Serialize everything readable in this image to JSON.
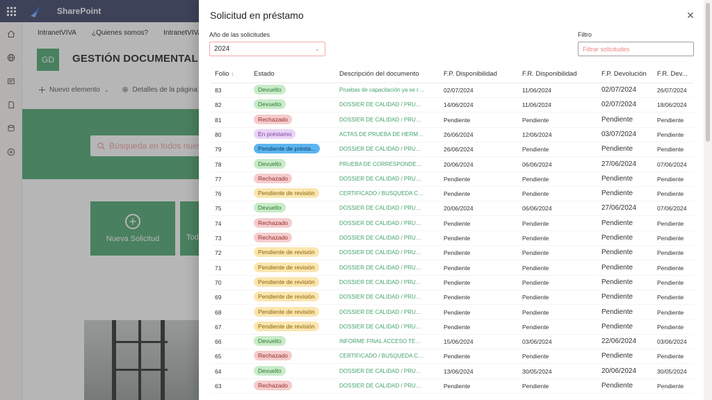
{
  "suite": {
    "app_name": "SharePoint"
  },
  "hub_nav": [
    "IntranetVIVA",
    "¿Quienes somos?",
    "IntranetVIVA"
  ],
  "site": {
    "logo_text": "GD",
    "title": "GESTIÓN DOCUMENTAL VIVA"
  },
  "command_bar": {
    "new_item": "Nuevo elemento",
    "page_details": "Detalles de la página"
  },
  "hero": {
    "search_placeholder": "Búsqueda en todos nuestros documentos"
  },
  "tiles": [
    {
      "label": "Nueva Solicitud"
    },
    {
      "label": "Todas"
    }
  ],
  "panel": {
    "title": "Solicitud en préstamo",
    "year_label": "Año de las solicitudes",
    "year_value": "2024",
    "filter_label": "Filtro",
    "filter_placeholder": "Filtrar solicitudes",
    "columns": {
      "folio": "Folio",
      "estado": "Estado",
      "descripcion": "Descripción del documento",
      "fp_disp": "F.P. Disponibilidad",
      "fr_disp": "F.R. Disponibilidad",
      "fp_dev": "F.P. Devolución",
      "fr_dev": "F.R. Dev..."
    },
    "rows": [
      {
        "folio": "83",
        "estado": "Devuelto",
        "status": "devuelto",
        "descripcion": "Pruebas de capacitación ya se re...",
        "fp_disp": "02/07/2024",
        "fr_disp": "11/06/2024",
        "fp_dev": "02/07/2024",
        "fr_dev": "26/07/2024"
      },
      {
        "folio": "82",
        "estado": "Devuelto",
        "status": "devuelto",
        "descripcion": "DOSSIER DE CALIDAD / PRUEBA...",
        "fp_disp": "14/06/2024",
        "fr_disp": "11/06/2024",
        "fp_dev": "02/07/2024",
        "fr_dev": "18/06/2024"
      },
      {
        "folio": "81",
        "estado": "Rechazado",
        "status": "rechazado",
        "descripcion": "DOSSIER DE CALIDAD / PRUEBA...",
        "fp_disp": "Pendiente",
        "fr_disp": "Pendiente",
        "fp_dev": "Pendiente",
        "fr_dev": "Pendiente"
      },
      {
        "folio": "80",
        "estado": "En préstamo",
        "status": "prestamo",
        "descripcion": "ACTAS DE PRUEBA DE HERMETI...",
        "fp_disp": "26/06/2024",
        "fr_disp": "12/06/2024",
        "fp_dev": "03/07/2024",
        "fr_dev": "Pendiente"
      },
      {
        "folio": "79",
        "estado": "Pendiente de présta...",
        "status": "pendprest",
        "descripcion": "DOSSIER DE CALIDAD / PRUEBA...",
        "fp_disp": "26/06/2024",
        "fr_disp": "Pendiente",
        "fp_dev": "Pendiente",
        "fr_dev": "Pendiente"
      },
      {
        "folio": "78",
        "estado": "Devuelto",
        "status": "devuelto",
        "descripcion": "PRUEBA DE CORRESPONDENCIA",
        "fp_disp": "20/06/2024",
        "fr_disp": "06/06/2024",
        "fp_dev": "27/06/2024",
        "fr_dev": "07/06/2024"
      },
      {
        "folio": "77",
        "estado": "Rechazado",
        "status": "rechazado",
        "descripcion": "DOSSIER DE CALIDAD / PRUEBA...",
        "fp_disp": "Pendiente",
        "fr_disp": "Pendiente",
        "fp_dev": "Pendiente",
        "fr_dev": "Pendiente"
      },
      {
        "folio": "76",
        "estado": "Pendiente de revisión",
        "status": "revision",
        "descripcion": "CERTIFICADO / BUSQUEDA CAT...",
        "fp_disp": "Pendiente",
        "fr_disp": "Pendiente",
        "fp_dev": "Pendiente",
        "fr_dev": "Pendiente"
      },
      {
        "folio": "75",
        "estado": "Devuelto",
        "status": "devuelto",
        "descripcion": "DOSSIER DE CALIDAD / PRUEBA...",
        "fp_disp": "20/06/2024",
        "fr_disp": "06/06/2024",
        "fp_dev": "27/06/2024",
        "fr_dev": "07/06/2024"
      },
      {
        "folio": "74",
        "estado": "Rechazado",
        "status": "rechazado",
        "descripcion": "DOSSIER DE CALIDAD / PRUEBA...",
        "fp_disp": "Pendiente",
        "fr_disp": "Pendiente",
        "fp_dev": "Pendiente",
        "fr_dev": "Pendiente"
      },
      {
        "folio": "73",
        "estado": "Rechazado",
        "status": "rechazado",
        "descripcion": "DOSSIER DE CALIDAD / PRUEBA...",
        "fp_disp": "Pendiente",
        "fr_disp": "Pendiente",
        "fp_dev": "Pendiente",
        "fr_dev": "Pendiente"
      },
      {
        "folio": "72",
        "estado": "Pendiente de revisión",
        "status": "revision",
        "descripcion": "DOSSIER DE CALIDAD / PRUEBA...",
        "fp_disp": "Pendiente",
        "fr_disp": "Pendiente",
        "fp_dev": "Pendiente",
        "fr_dev": "Pendiente"
      },
      {
        "folio": "71",
        "estado": "Pendiente de revisión",
        "status": "revision",
        "descripcion": "DOSSIER DE CALIDAD / PRUEBA...",
        "fp_disp": "Pendiente",
        "fr_disp": "Pendiente",
        "fp_dev": "Pendiente",
        "fr_dev": "Pendiente"
      },
      {
        "folio": "70",
        "estado": "Pendiente de revisión",
        "status": "revision",
        "descripcion": "DOSSIER DE CALIDAD / PRUEBA...",
        "fp_disp": "Pendiente",
        "fr_disp": "Pendiente",
        "fp_dev": "Pendiente",
        "fr_dev": "Pendiente"
      },
      {
        "folio": "69",
        "estado": "Pendiente de revisión",
        "status": "revision",
        "descripcion": "DOSSIER DE CALIDAD / PRUEBA...",
        "fp_disp": "Pendiente",
        "fr_disp": "Pendiente",
        "fp_dev": "Pendiente",
        "fr_dev": "Pendiente"
      },
      {
        "folio": "68",
        "estado": "Pendiente de revisión",
        "status": "revision",
        "descripcion": "DOSSIER DE CALIDAD / PRUEBA...",
        "fp_disp": "Pendiente",
        "fr_disp": "Pendiente",
        "fp_dev": "Pendiente",
        "fr_dev": "Pendiente"
      },
      {
        "folio": "67",
        "estado": "Pendiente de revisión",
        "status": "revision",
        "descripcion": "DOSSIER DE CALIDAD / PRUEBA...",
        "fp_disp": "Pendiente",
        "fr_disp": "Pendiente",
        "fp_dev": "Pendiente",
        "fr_dev": "Pendiente"
      },
      {
        "folio": "66",
        "estado": "Devuelto",
        "status": "devuelto",
        "descripcion": "INFORME FINAL ACCESO TEMP...",
        "fp_disp": "15/06/2024",
        "fr_disp": "03/06/2024",
        "fp_dev": "22/06/2024",
        "fr_dev": "03/06/2024"
      },
      {
        "folio": "65",
        "estado": "Rechazado",
        "status": "rechazado",
        "descripcion": "CERTIFICADO / BUSQUEDA CAT...",
        "fp_disp": "Pendiente",
        "fr_disp": "Pendiente",
        "fp_dev": "Pendiente",
        "fr_dev": "Pendiente"
      },
      {
        "folio": "64",
        "estado": "Devuelto",
        "status": "devuelto",
        "descripcion": "DOSSIER DE CALIDAD / PRUEBA...",
        "fp_disp": "13/06/2024",
        "fr_disp": "30/05/2024",
        "fp_dev": "20/06/2024",
        "fr_dev": "30/05/2024"
      },
      {
        "folio": "63",
        "estado": "Rechazado",
        "status": "rechazado",
        "descripcion": "DOSSIER DE CALIDAD / PRUEBA...",
        "fp_disp": "Pendiente",
        "fr_disp": "Pendiente",
        "fp_dev": "Pendiente",
        "fr_dev": "Pendiente"
      }
    ]
  },
  "colors": {
    "brand_green": "#5aad7c",
    "suite_bar": "#4a4f73",
    "status_devuelto": "#c8ebc8",
    "status_rechazado": "#f5cccc",
    "status_revision": "#fbe6b0",
    "status_prestamo": "#ead3f7",
    "status_pendiente_prestamo": "#5bb5f0"
  }
}
